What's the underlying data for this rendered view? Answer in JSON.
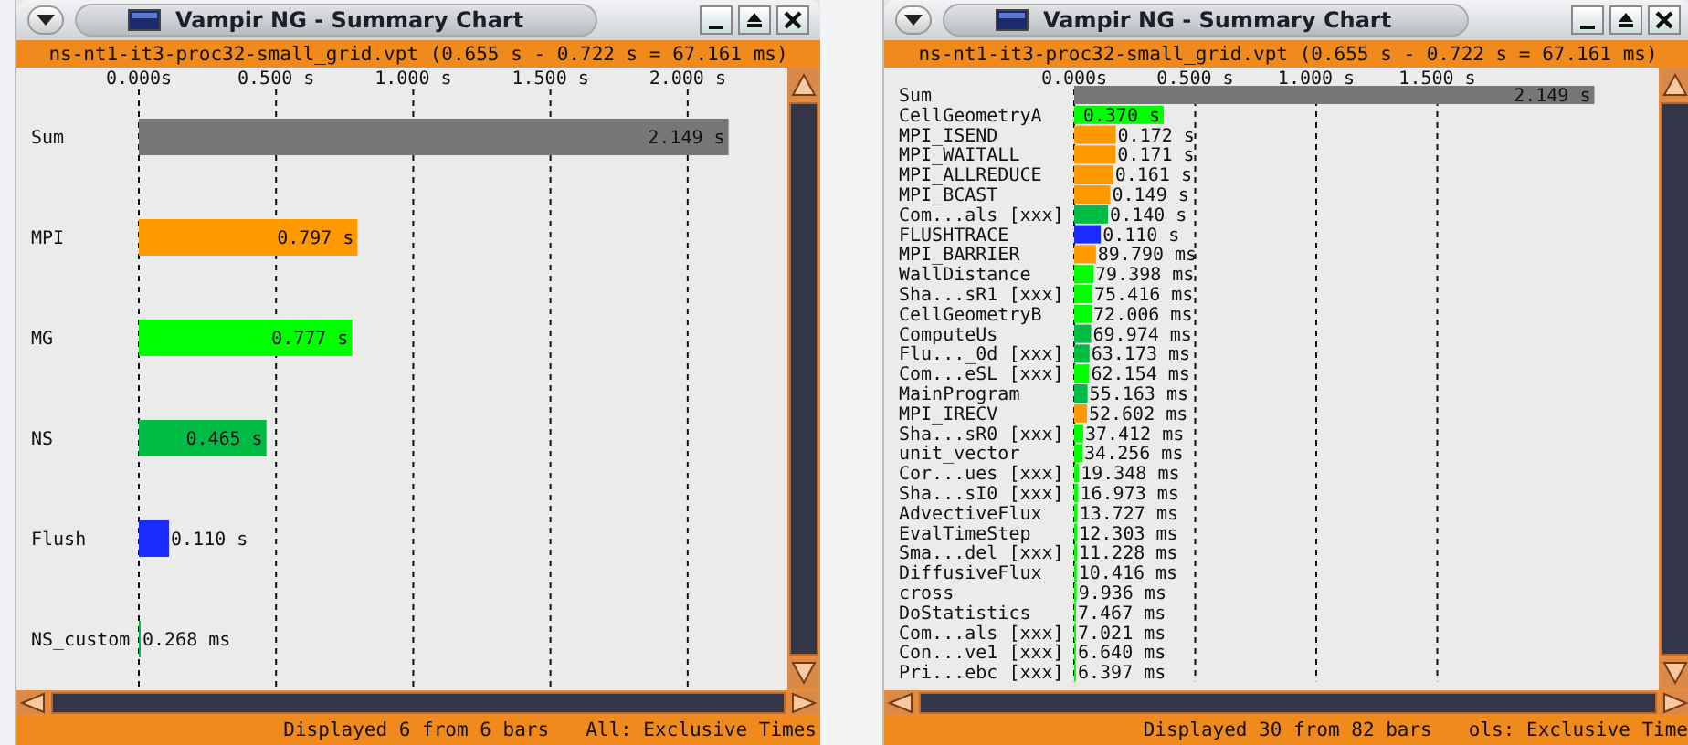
{
  "windows": [
    {
      "title": "Vampir NG - Summary Chart",
      "file_info": "ns-nt1-it3-proc32-small_grid.vpt (0.655 s - 0.722 s = 67.161 ms)",
      "status": "Displayed 6 from 6 bars",
      "mode": "All: Exclusive Times",
      "chart_data": {
        "type": "bar",
        "orientation": "horizontal",
        "grid": true,
        "categories": [
          "Sum",
          "MPI",
          "MG",
          "NS",
          "Flush",
          "NS_custom"
        ],
        "series": [
          {
            "color": "#777777",
            "values": [
              2.149,
              null,
              null,
              null,
              null,
              null
            ]
          },
          {
            "color": "#ff9900",
            "values": [
              null,
              0.797,
              null,
              null,
              null,
              null
            ]
          },
          {
            "color": "#00ff00",
            "values": [
              null,
              null,
              0.777,
              null,
              null,
              null
            ]
          },
          {
            "color": "#00bb44",
            "values": [
              null,
              null,
              null,
              0.465,
              null,
              0.000268
            ]
          },
          {
            "color": "#1a2cff",
            "values": [
              null,
              null,
              null,
              null,
              0.11,
              null
            ]
          }
        ],
        "value_labels": [
          "2.149 s",
          "0.797 s",
          "0.777 s",
          "0.465 s",
          "0.110 s",
          "0.268 ms"
        ],
        "xlim": [
          0,
          2.35
        ],
        "xticks": [
          {
            "value": 0,
            "label": "0.000s"
          },
          {
            "value": 0.5,
            "label": "0.500 s"
          },
          {
            "value": 1,
            "label": "1.000 s"
          },
          {
            "value": 1.5,
            "label": "1.500 s"
          },
          {
            "value": 2,
            "label": "2.000 s"
          }
        ]
      }
    },
    {
      "title": "Vampir NG - Summary Chart",
      "file_info": "ns-nt1-it3-proc32-small_grid.vpt (0.655 s - 0.722 s = 67.161 ms)",
      "status": "Displayed 30 from 82 bars",
      "mode": "ols: Exclusive Time",
      "chart_data": {
        "type": "bar",
        "orientation": "horizontal",
        "grid": true,
        "categories": [
          "Sum",
          "CellGeometryA",
          "MPI_ISEND",
          "MPI_WAITALL",
          "MPI_ALLREDUCE",
          "MPI_BCAST",
          "Com...als [xxx]",
          "FLUSHTRACE",
          "MPI_BARRIER",
          "WallDistance",
          "Sha...sR1 [xxx]",
          "CellGeometryB",
          "ComputeUs",
          "Flu..._0d [xxx]",
          "Com...eSL [xxx]",
          "MainProgram",
          "MPI_IRECV",
          "Sha...sR0 [xxx]",
          "unit_vector",
          "Cor...ues [xxx]",
          "Sha...sI0 [xxx]",
          "AdvectiveFlux",
          "EvalTimeStep",
          "Sma...del [xxx]",
          "DiffusiveFlux",
          "cross",
          "DoStatistics",
          "Com...als [xxx]",
          "Con...ve1 [xxx]",
          "Pri...ebc [xxx]"
        ],
        "series": [
          {
            "color": "#777777",
            "values": [
              2.149,
              null,
              null,
              null,
              null,
              null,
              null,
              null,
              null,
              null,
              null,
              null,
              null,
              null,
              null,
              null,
              null,
              null,
              null,
              null,
              null,
              null,
              null,
              null,
              null,
              null,
              null,
              null,
              null,
              null
            ]
          },
          {
            "color": "#ff9900",
            "values": [
              null,
              null,
              0.172,
              0.171,
              0.161,
              0.149,
              null,
              null,
              0.08979,
              null,
              null,
              null,
              null,
              null,
              null,
              null,
              0.052602,
              null,
              null,
              null,
              null,
              null,
              null,
              null,
              null,
              null,
              null,
              null,
              null,
              null
            ]
          },
          {
            "color": "#00ff00",
            "values": [
              null,
              0.37,
              null,
              null,
              null,
              null,
              null,
              null,
              null,
              0.079398,
              0.075416,
              0.072006,
              null,
              null,
              0.062154,
              null,
              null,
              0.037412,
              0.034256,
              0.019348,
              0.016973,
              0.013727,
              0.012303,
              0.011228,
              0.010416,
              0.009936,
              0.007467,
              0.007021,
              0.00664,
              0.006397
            ]
          },
          {
            "color": "#00bb44",
            "values": [
              null,
              null,
              null,
              null,
              null,
              null,
              0.14,
              null,
              null,
              null,
              null,
              null,
              0.069974,
              0.063173,
              null,
              0.055163,
              null,
              null,
              null,
              null,
              null,
              null,
              null,
              null,
              null,
              null,
              null,
              null,
              null,
              null
            ]
          },
          {
            "color": "#1a2cff",
            "values": [
              null,
              null,
              null,
              null,
              null,
              null,
              null,
              0.11,
              null,
              null,
              null,
              null,
              null,
              null,
              null,
              null,
              null,
              null,
              null,
              null,
              null,
              null,
              null,
              null,
              null,
              null,
              null,
              null,
              null,
              null
            ]
          }
        ],
        "value_labels": [
          "2.149 s",
          "0.370 s",
          "0.172 s",
          "0.171 s",
          "0.161 s",
          "0.149 s",
          "0.140 s",
          "0.110 s",
          "89.790 ms",
          "79.398 ms",
          "75.416 ms",
          "72.006 ms",
          "69.974 ms",
          "63.173 ms",
          "62.154 ms",
          "55.163 ms",
          "52.602 ms",
          "37.412 ms",
          "34.256 ms",
          "19.348 ms",
          "16.973 ms",
          "13.727 ms",
          "12.303 ms",
          "11.228 ms",
          "10.416 ms",
          "9.936 ms",
          "7.467 ms",
          "7.021 ms",
          "6.640 ms",
          "6.397 ms"
        ],
        "xlim": [
          0,
          2.4
        ],
        "xticks": [
          {
            "value": 0,
            "label": "0.000s"
          },
          {
            "value": 0.5,
            "label": "0.500 s"
          },
          {
            "value": 1,
            "label": "1.000 s"
          },
          {
            "value": 1.5,
            "label": "1.500 s"
          }
        ]
      }
    }
  ]
}
